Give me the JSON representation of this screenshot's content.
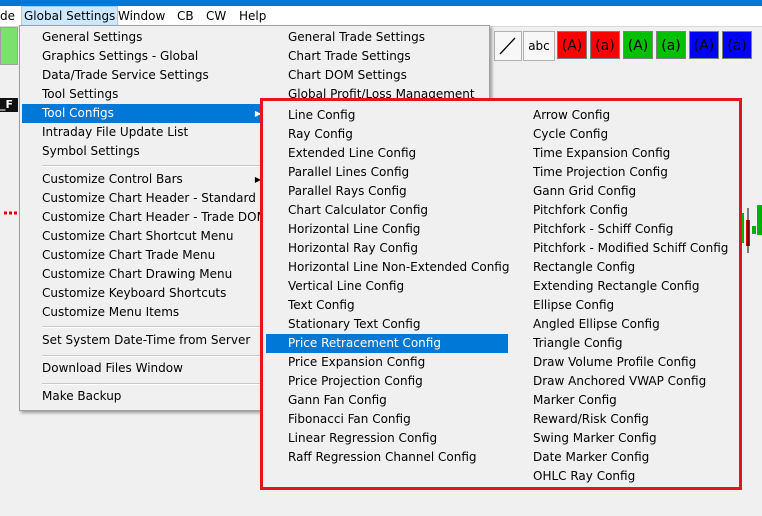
{
  "menubar": {
    "items": [
      "de",
      "Global Settings",
      "Window",
      "CB",
      "CW",
      "Help"
    ]
  },
  "toolbar": {
    "abc_label": "abc",
    "color_buttons": [
      {
        "label": "(A)",
        "color": "#ff0000"
      },
      {
        "label": "(a)",
        "color": "#ff0000"
      },
      {
        "label": "(A)",
        "color": "#00c000"
      },
      {
        "label": "(a)",
        "color": "#00c000"
      },
      {
        "label": "(A)",
        "color": "#0000ff"
      },
      {
        "label": "(a)",
        "color": "#0000ff"
      }
    ]
  },
  "chart": {
    "label": "_F"
  },
  "global_menu": {
    "left": [
      "General Settings",
      "Graphics Settings - Global",
      "Data/Trade Service Settings",
      "Tool Settings",
      "Tool Configs",
      "Intraday File Update List",
      "Symbol Settings",
      "Customize Control Bars",
      "Customize Chart Header - Standard",
      "Customize Chart Header - Trade DOM",
      "Customize Chart Shortcut Menu",
      "Customize Chart Trade Menu",
      "Customize Chart Drawing Menu",
      "Customize Keyboard Shortcuts",
      "Customize Menu Items",
      "Set System Date-Time from Server",
      "Download Files Window",
      "Make Backup"
    ],
    "right": [
      "General Trade Settings",
      "Chart Trade Settings",
      "Chart DOM Settings",
      "Global Profit/Loss Management"
    ]
  },
  "tool_configs": {
    "col1": [
      "Line Config",
      "Ray Config",
      "Extended Line Config",
      "Parallel Lines Config",
      "Parallel Rays Config",
      "Chart Calculator Config",
      "Horizontal Line Config",
      "Horizontal Ray Config",
      "Horizontal Line Non-Extended Config",
      "Vertical Line Config",
      "Text Config",
      "Stationary Text Config",
      "Price Retracement Config",
      "Price Expansion Config",
      "Price Projection Config",
      "Gann Fan Config",
      "Fibonacci Fan Config",
      "Linear Regression Config",
      "Raff Regression Channel Config"
    ],
    "col2": [
      "Arrow Config",
      "Cycle Config",
      "Time Expansion Config",
      "Time Projection Config",
      "Gann Grid Config",
      "Pitchfork Config",
      "Pitchfork - Schiff Config",
      "Pitchfork - Modified Schiff Config",
      "Rectangle Config",
      "Extending Rectangle Config",
      "Ellipse Config",
      "Angled Ellipse Config",
      "Triangle Config",
      "Draw Volume Profile Config",
      "Draw Anchored VWAP Config",
      "Marker Config",
      "Reward/Risk Config",
      "Swing Marker Config",
      "Date Marker Config",
      "OHLC Ray Config"
    ],
    "highlight_color": "#0078d7",
    "border_color": "#e8141c"
  }
}
